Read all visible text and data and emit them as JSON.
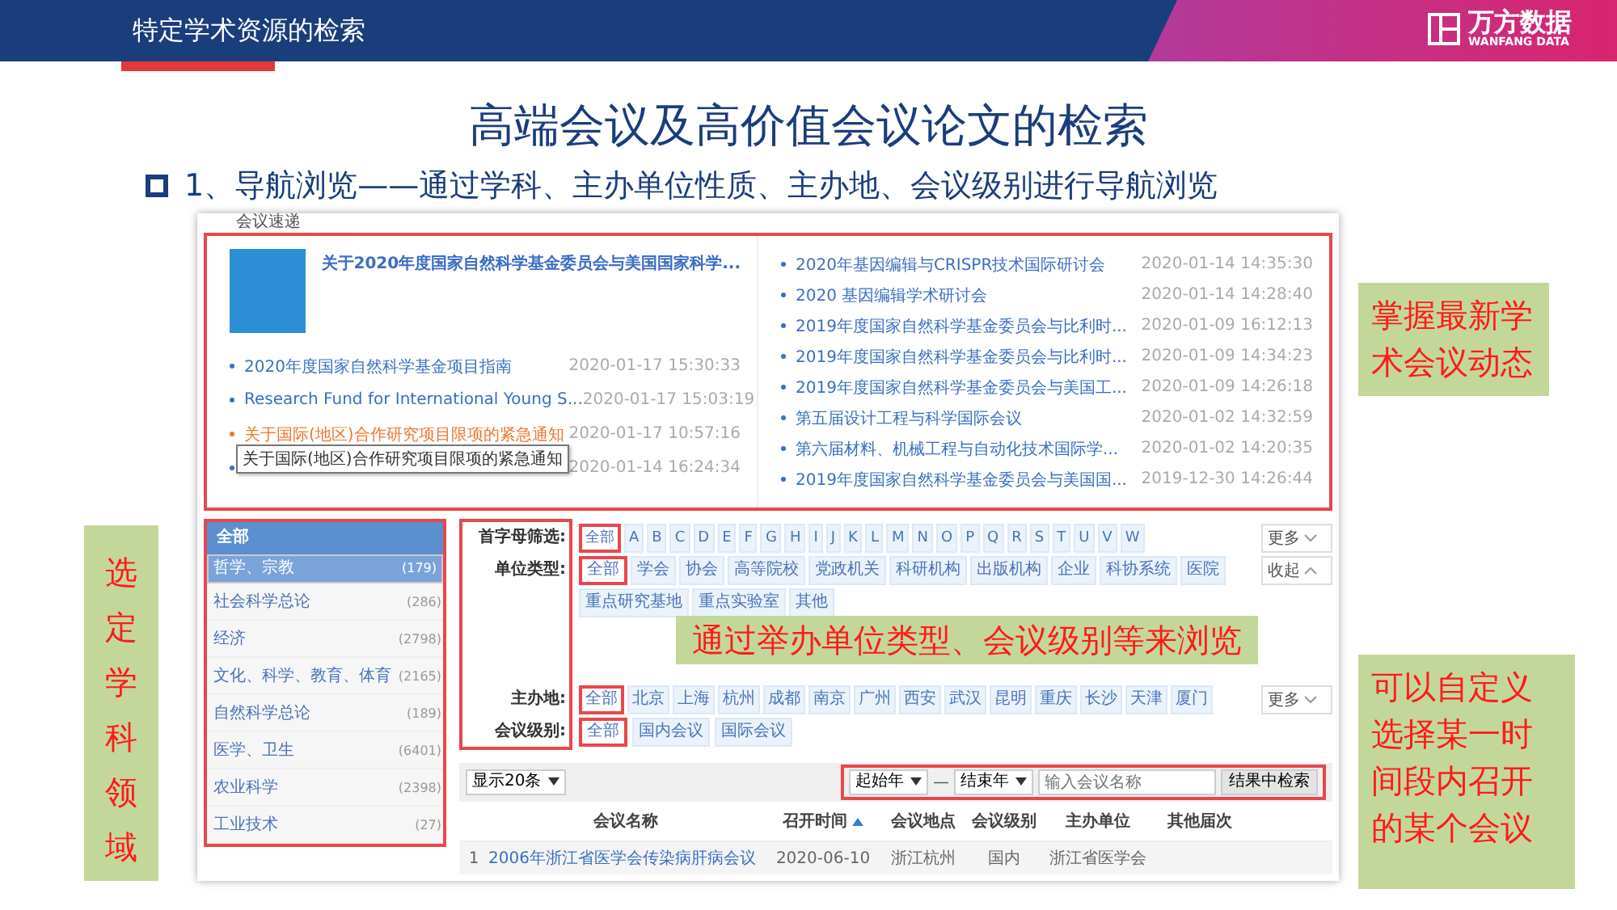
{
  "header": {
    "title": "特定学术资源的检索",
    "logo_text": "万方数据",
    "logo_subtext": "WANFANG DATA"
  },
  "slide_title": "高端会议及高价值会议论文的检索",
  "bullet": "1、导航浏览——通过学科、主办单位性质、主办地、会议级别进行导航浏览",
  "screenshot": {
    "section_title": "会议速递",
    "featured": {
      "title": "关于2020年度国家自然科学基金委员会与美国国家科学..."
    },
    "news_left": [
      {
        "title": "2020年度国家自然科学基金项目指南",
        "date": "2020-01-17 15:30:33",
        "hovered": false
      },
      {
        "title": "Research Fund for International Young S...",
        "date": "2020-01-17 15:03:19",
        "hovered": false
      },
      {
        "title": "关于国际(地区)合作研究项目限项的紧急通知",
        "date": "2020-01-17 10:57:16",
        "hovered": true,
        "tooltip": "关于国际(地区)合作研究项目限项的紧急通知"
      },
      {
        "date": "2020-01-14 16:24:34",
        "hovered": false
      }
    ],
    "news_right": [
      {
        "title": "2020年基因编辑与CRISPR技术国际研讨会",
        "date": "2020-01-14 14:35:30"
      },
      {
        "title": "2020 基因编辑学术研讨会",
        "date": "2020-01-14 14:28:40"
      },
      {
        "title": "2019年度国家自然科学基金委员会与比利时...",
        "date": "2020-01-09 16:12:13"
      },
      {
        "title": "2019年度国家自然科学基金委员会与比利时...",
        "date": "2020-01-09 14:34:23"
      },
      {
        "title": "2019年度国家自然科学基金委员会与美国工...",
        "date": "2020-01-09 14:26:18"
      },
      {
        "title": "第五届设计工程与科学国际会议",
        "date": "2020-01-02 14:32:59"
      },
      {
        "title": "第六届材料、机械工程与自动化技术国际学...",
        "date": "2020-01-02 14:20:35"
      },
      {
        "title": "2019年度国家自然科学基金委员会与美国国...",
        "date": "2019-12-30 14:26:44"
      }
    ],
    "category_header": "全部",
    "categories": [
      {
        "label": "哲学、宗教",
        "count": "(179)",
        "selected": true
      },
      {
        "label": "社会科学总论",
        "count": "(286)",
        "selected": false
      },
      {
        "label": "经济",
        "count": "(2798)",
        "selected": false
      },
      {
        "label": "文化、科学、教育、体育",
        "count": "(2165)",
        "selected": false
      },
      {
        "label": "自然科学总论",
        "count": "(189)",
        "selected": false
      },
      {
        "label": "医学、卫生",
        "count": "(6401)",
        "selected": false
      },
      {
        "label": "农业科学",
        "count": "(2398)",
        "selected": false
      },
      {
        "label": "工业技术",
        "count": "(27)",
        "selected": false
      }
    ],
    "filters": [
      {
        "label": "首字母筛选:",
        "toggle": "更多",
        "toggle_expanded": false,
        "options": [
          {
            "label": "全部",
            "selected": true
          },
          {
            "label": "A",
            "selected": false
          },
          {
            "label": "B",
            "selected": false
          },
          {
            "label": "C",
            "selected": false
          },
          {
            "label": "D",
            "selected": false
          },
          {
            "label": "E",
            "selected": false
          },
          {
            "label": "F",
            "selected": false
          },
          {
            "label": "G",
            "selected": false
          },
          {
            "label": "H",
            "selected": false
          },
          {
            "label": "I",
            "selected": false
          },
          {
            "label": "J",
            "selected": false
          },
          {
            "label": "K",
            "selected": false
          },
          {
            "label": "L",
            "selected": false
          },
          {
            "label": "M",
            "selected": false
          },
          {
            "label": "N",
            "selected": false
          },
          {
            "label": "O",
            "selected": false
          },
          {
            "label": "P",
            "selected": false
          },
          {
            "label": "Q",
            "selected": false
          },
          {
            "label": "R",
            "selected": false
          },
          {
            "label": "S",
            "selected": false
          },
          {
            "label": "T",
            "selected": false
          },
          {
            "label": "U",
            "selected": false
          },
          {
            "label": "V",
            "selected": false
          },
          {
            "label": "W",
            "selected": false
          }
        ]
      },
      {
        "label": "单位类型:",
        "toggle": "收起",
        "toggle_expanded": true,
        "options": [
          {
            "label": "全部",
            "selected": true
          },
          {
            "label": "学会",
            "selected": false
          },
          {
            "label": "协会",
            "selected": false
          },
          {
            "label": "高等院校",
            "selected": false
          },
          {
            "label": "党政机关",
            "selected": false
          },
          {
            "label": "科研机构",
            "selected": false
          },
          {
            "label": "出版机构",
            "selected": false
          },
          {
            "label": "企业",
            "selected": false
          },
          {
            "label": "科协系统",
            "selected": false
          },
          {
            "label": "医院",
            "selected": false
          },
          {
            "label": "重点研究基地",
            "selected": false
          },
          {
            "label": "重点实验室",
            "selected": false
          },
          {
            "label": "其他",
            "selected": false
          }
        ]
      },
      {
        "label": "主办地:",
        "toggle": "更多",
        "toggle_expanded": false,
        "options": [
          {
            "label": "全部",
            "selected": true
          },
          {
            "label": "北京",
            "selected": false
          },
          {
            "label": "上海",
            "selected": false
          },
          {
            "label": "杭州",
            "selected": false
          },
          {
            "label": "成都",
            "selected": false
          },
          {
            "label": "南京",
            "selected": false
          },
          {
            "label": "广州",
            "selected": false
          },
          {
            "label": "西安",
            "selected": false
          },
          {
            "label": "武汉",
            "selected": false
          },
          {
            "label": "昆明",
            "selected": false
          },
          {
            "label": "重庆",
            "selected": false
          },
          {
            "label": "长沙",
            "selected": false
          },
          {
            "label": "天津",
            "selected": false
          },
          {
            "label": "厦门",
            "selected": false
          }
        ]
      },
      {
        "label": "会议级别:",
        "options": [
          {
            "label": "全部",
            "selected": true
          },
          {
            "label": "国内会议",
            "selected": false
          },
          {
            "label": "国际会议",
            "selected": false
          }
        ]
      }
    ],
    "page_size": "显示20条",
    "start_year": "起始年",
    "dash": "—",
    "end_year": "结束年",
    "search_placeholder": "输入会议名称",
    "search_button": "结果中检索",
    "table": {
      "columns": [
        {
          "label": "会议名称",
          "sorted": false
        },
        {
          "label": "召开时间",
          "sorted": true
        },
        {
          "label": "会议地点",
          "sorted": false
        },
        {
          "label": "会议级别",
          "sorted": false
        },
        {
          "label": "主办单位",
          "sorted": false
        },
        {
          "label": "其他届次",
          "sorted": false
        }
      ],
      "rows": [
        {
          "index": "1",
          "cells": [
            "2006年浙江省医学会传染病肝病会议",
            "2020-06-10",
            "浙江杭州",
            "国内",
            "浙江省医学会"
          ]
        }
      ]
    }
  },
  "callouts": [
    {
      "text": "掌握最新学术会议动态",
      "kind": "box"
    },
    {
      "text": "选定学科领域",
      "kind": "vertical"
    },
    {
      "text": "通过举办单位类型、会议级别等来浏览",
      "kind": "banner"
    },
    {
      "text": "可以自定义选择某一时间段内召开的某个会议",
      "kind": "box"
    }
  ]
}
